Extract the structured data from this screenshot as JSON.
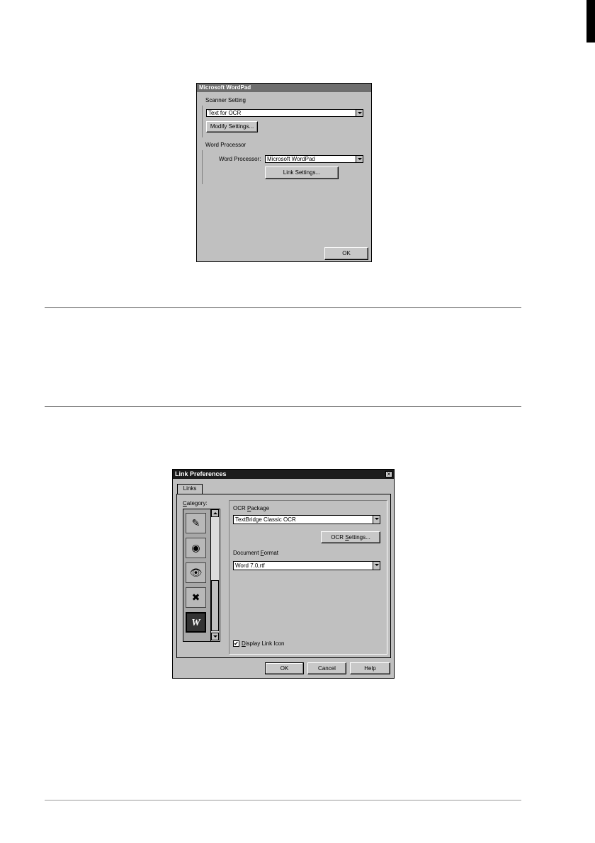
{
  "wordpad_dialog": {
    "title": "Microsoft WordPad",
    "scanner_group_label": "Scanner Setting",
    "scanner_setting_value": "Text for OCR",
    "modify_button": "Modify Settings...",
    "word_group_label": "Word Processor",
    "word_processor_label": "Word Processor:",
    "word_processor_value": "Microsoft WordPad",
    "link_settings_button": "Link Settings...",
    "ok_button": "OK"
  },
  "link_prefs_dialog": {
    "title": "Link Preferences",
    "close_glyph": "✕",
    "tab_links": "Links",
    "category_label_prefix": "C",
    "category_label_rest": "ategory:",
    "category_icons": [
      {
        "icon": "paint-brushes-icon",
        "glyph": "✎"
      },
      {
        "icon": "palette-icon",
        "glyph": "◉"
      },
      {
        "icon": "eye-icon",
        "glyph": "👁"
      },
      {
        "icon": "fax-icon",
        "glyph": "✖"
      },
      {
        "icon": "word-icon",
        "glyph": "W"
      }
    ],
    "ocr_package_label_pre": "OCR ",
    "ocr_package_label_u": "P",
    "ocr_package_label_post": "ackage",
    "ocr_package_value": "TextBridge Classic OCR",
    "ocr_settings_pre": "OCR ",
    "ocr_settings_u": "S",
    "ocr_settings_post": "ettings...",
    "document_format_pre": "Document ",
    "document_format_u": "F",
    "document_format_post": "ormat",
    "document_format_value": "Word 7.0,rtf",
    "display_link_check": "✔",
    "display_link_u": "D",
    "display_link_post": "isplay Link Icon",
    "ok_button": "OK",
    "cancel_button": "Cancel",
    "help_button": "Help"
  }
}
